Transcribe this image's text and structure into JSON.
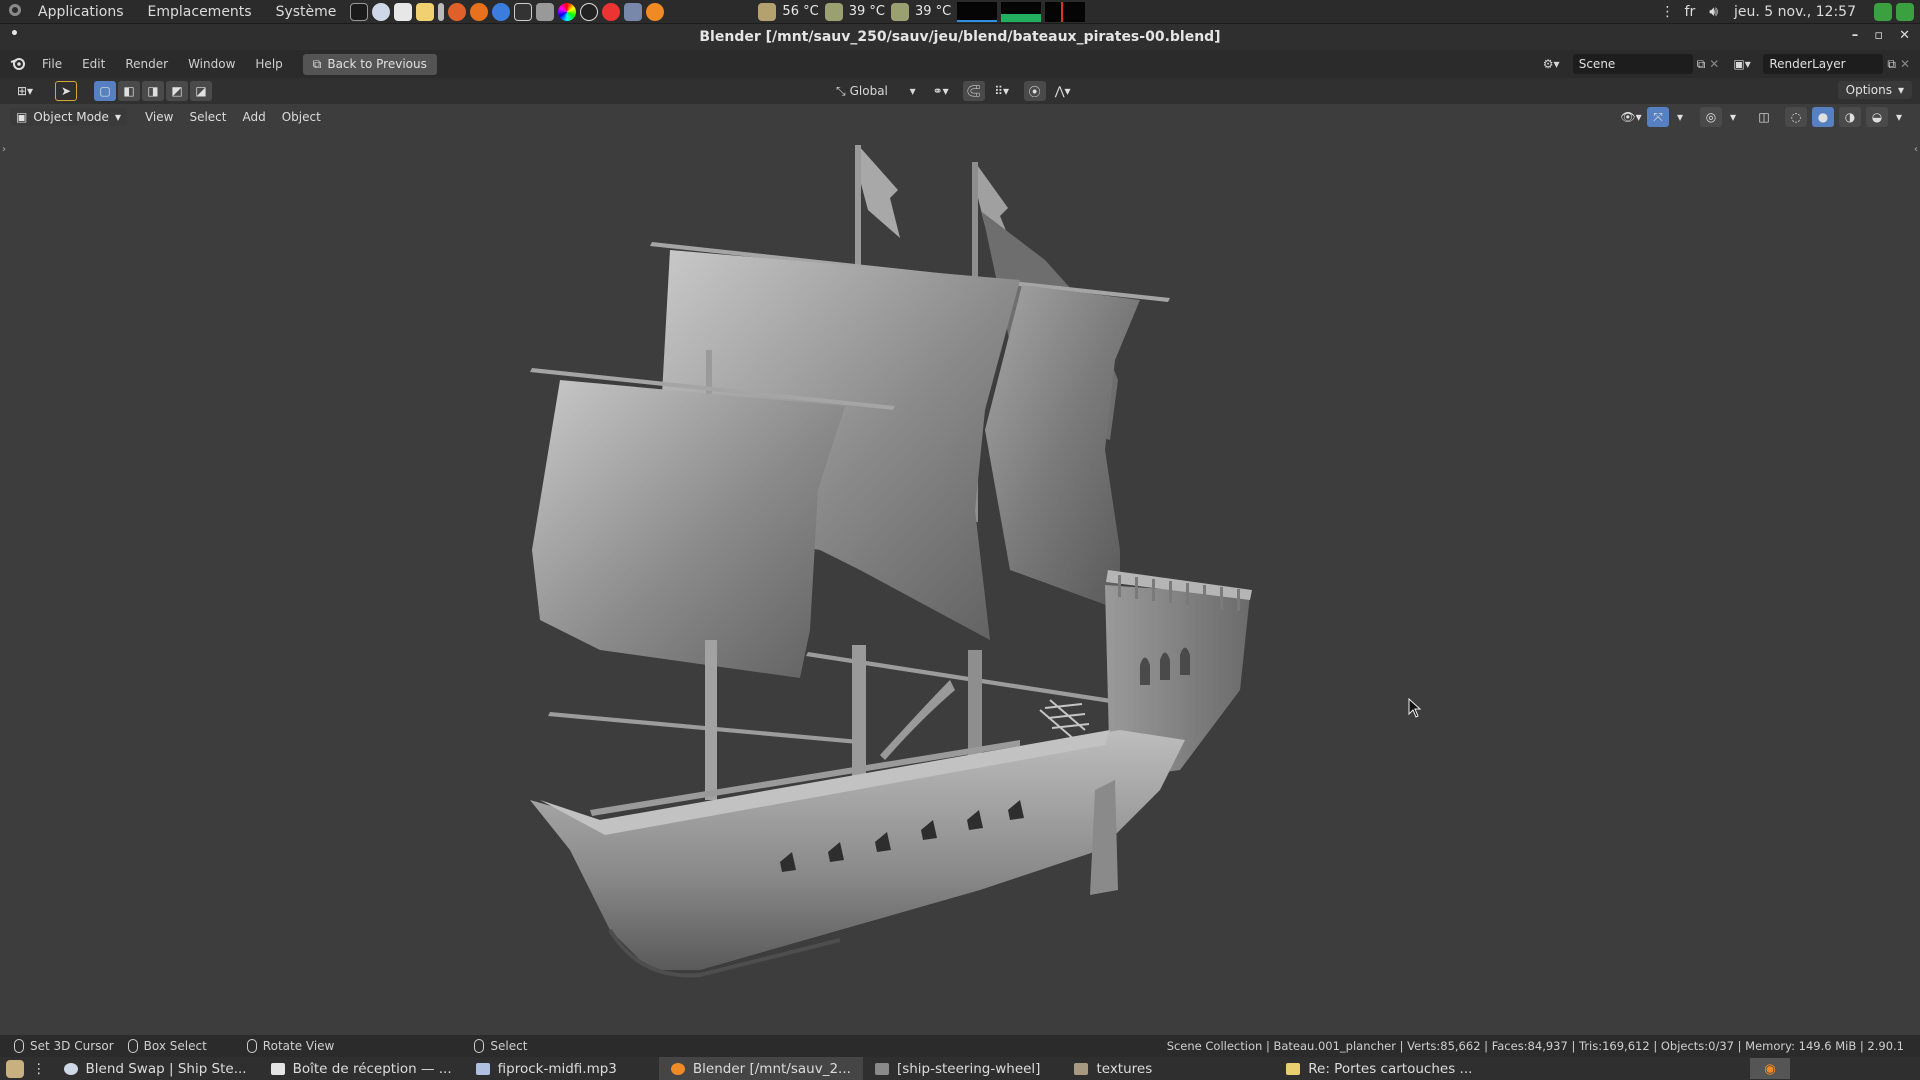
{
  "system_panel": {
    "menus": [
      "Applications",
      "Emplacements",
      "Système"
    ],
    "temps": [
      "56 °C",
      "39 °C",
      "39 °C"
    ],
    "keyboard_layout": "fr",
    "clock": "jeu. 5 nov., 12:57"
  },
  "window": {
    "title": "Blender [/mnt/sauv_250/sauv/jeu/blend/bateaux_pirates-00.blend]"
  },
  "blender_header": {
    "menus": [
      "File",
      "Edit",
      "Render",
      "Window",
      "Help"
    ],
    "back_button": "Back to Previous",
    "scene_name": "Scene",
    "render_layer": "RenderLayer"
  },
  "tool_settings": {
    "orientation": "Global",
    "options_label": "Options"
  },
  "viewport_header": {
    "mode": "Object Mode",
    "menus": [
      "View",
      "Select",
      "Add",
      "Object"
    ]
  },
  "status_bar": {
    "hints": [
      "Set 3D Cursor",
      "Box Select",
      "Rotate View",
      "Select"
    ],
    "stats": "Scene Collection | Bateau.001_plancher | Verts:85,662 | Faces:84,937 | Tris:169,612 | Objects:0/37 | Memory: 149.6 MiB | 2.90.1"
  },
  "taskbar": {
    "tasks": [
      "Blend Swap | Ship Ste...",
      "Boîte de réception — ...",
      "fiprock-midfi.mp3",
      "Blender [/mnt/sauv_2...",
      "[ship-steering-wheel]",
      "textures",
      "Re: Portes cartouches ..."
    ]
  },
  "colors": {
    "accent": "#5680c2",
    "viewport_bg": "#3d3d3d",
    "panel_bg": "#2b2b2b"
  }
}
